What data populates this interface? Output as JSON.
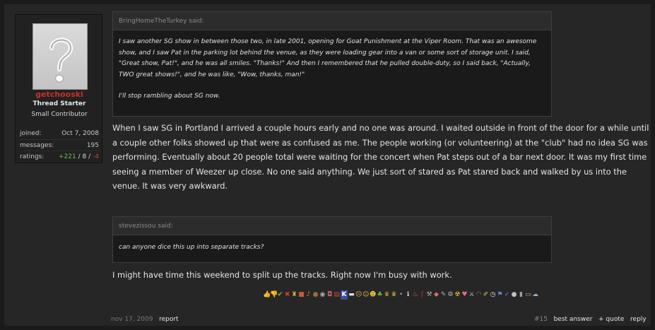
{
  "user": {
    "avatar_icon": "question-mark-avatar-icon",
    "name": "getchooski",
    "title": "Thread Starter",
    "rank": "Small Contributor",
    "stats": {
      "joined_label": "joined:",
      "joined_value": "Oct 7, 2008",
      "messages_label": "messages:",
      "messages_value": "195",
      "ratings_label": "ratings:",
      "ratings_pos": "+221",
      "ratings_sep1": " / ",
      "ratings_neu": "8",
      "ratings_sep2": " / ",
      "ratings_neg": "-4"
    }
  },
  "quote1": {
    "author": "BringHomeTheTurkey said:",
    "para1": "I saw another SG show in between those two, in late 2001, opening for Goat Punishment at the Viper Room. That was an awesome show, and I saw Pat in the parking lot behind the venue, as they were loading gear into a van or some sort of storage unit. I said, \"Great show, Pat!\", and he was all smiles. \"Thanks!\" And then I remembered that he pulled double-duty, so I said back, \"Actually, TWO great shows!\", and he was like, \"Wow, thanks, man!\"",
    "para2": "I'll stop rambling about SG now."
  },
  "message1": "When I saw SG in Portland I arrived a couple hours early and no one was around. I waited outside in front of the door for a while until a couple other folks showed up that were as confused as me. The people working (or volunteering) at the \"club\" had no idea SG was performing. Eventually about 20 people total were waiting for the concert when Pat steps out of a bar next door. It was my first time seeing a member of Weezer up close. No one said anything. We just sort of stared as Pat stared back and walked by us into the venue. It was very awkward.",
  "quote2": {
    "author": "stevezissou said:",
    "body": "can anyone dice this up into separate tracks?"
  },
  "message2": "I might have time this weekend to split up the tracks. Right now I'm busy with work.",
  "reactions": [
    {
      "name": "thumbs-up-icon",
      "glyph": "👍",
      "color": "#d9a066"
    },
    {
      "name": "thumbs-down-icon",
      "glyph": "👎",
      "color": "#c8843a"
    },
    {
      "name": "checkmark-icon",
      "glyph": "✔",
      "color": "#6cc04a"
    },
    {
      "name": "x-icon",
      "glyph": "✖",
      "color": "#d23b2f"
    },
    {
      "name": "trophy-icon",
      "glyph": "♜",
      "color": "#d9b44a"
    },
    {
      "name": "gift-icon",
      "glyph": "■",
      "color": "#c85a3a"
    },
    {
      "name": "guitar-icon",
      "glyph": "♪",
      "color": "#d98a3a"
    },
    {
      "name": "football-icon",
      "glyph": "●",
      "color": "#9a6a3a"
    },
    {
      "name": "disc-icon",
      "glyph": "◉",
      "color": "#b0b0b0"
    },
    {
      "name": "drum-icon",
      "glyph": "◘",
      "color": "#c85a5a"
    },
    {
      "name": "book-icon",
      "glyph": "▤",
      "color": "#c04a4a"
    },
    {
      "name": "k-icon",
      "glyph": "K",
      "color": "#ffffff"
    },
    {
      "name": "boat-icon",
      "glyph": "▬",
      "color": "#e0e0e0"
    },
    {
      "name": "sad-face-icon",
      "glyph": "☹",
      "color": "#e8c23a"
    },
    {
      "name": "surprised-face-icon",
      "glyph": "☺",
      "color": "#e8c23a"
    },
    {
      "name": "smile-face-icon",
      "glyph": "☻",
      "color": "#e8c23a"
    },
    {
      "name": "frog-icon",
      "glyph": "♣",
      "color": "#6cae4a"
    },
    {
      "name": "crown-icon",
      "glyph": "♛",
      "color": "#d9a03a"
    },
    {
      "name": "crown-icon-2",
      "glyph": "♛",
      "color": "#e0b040"
    },
    {
      "name": "dot-icon",
      "glyph": "•",
      "color": "#a0a0a0"
    },
    {
      "name": "info-icon",
      "glyph": "ℹ",
      "color": "#e0e0e0"
    },
    {
      "name": "fire-icon",
      "glyph": "♨",
      "color": "#e06a2a"
    },
    {
      "name": "chili-icon",
      "glyph": "ʃ",
      "color": "#d23b2f"
    },
    {
      "name": "wrench-icon",
      "glyph": "⚒",
      "color": "#b0b0b0"
    },
    {
      "name": "pill-icon",
      "glyph": "◆",
      "color": "#e06a6a"
    },
    {
      "name": "syringe-icon",
      "glyph": "✎",
      "color": "#b0b0b0"
    },
    {
      "name": "gear-icon",
      "glyph": "⚙",
      "color": "#c0c0c0"
    },
    {
      "name": "radiation-icon",
      "glyph": "☢",
      "color": "#e8c23a"
    },
    {
      "name": "heart-icon",
      "glyph": "♥",
      "color": "#e06a8a"
    },
    {
      "name": "tools-icon",
      "glyph": "⚔",
      "color": "#c0c0c0"
    },
    {
      "name": "rainbow-icon",
      "glyph": "◠",
      "color": "#d98a3a"
    },
    {
      "name": "pencil-icon",
      "glyph": "✐",
      "color": "#e0c04a"
    },
    {
      "name": "clock-icon",
      "glyph": "◷",
      "color": "#e0e0e0"
    },
    {
      "name": "flag-icon",
      "glyph": "⚑",
      "color": "#6a8ad0"
    },
    {
      "name": "check-circle-icon",
      "glyph": "✓",
      "color": "#6a8ad0"
    },
    {
      "name": "speech-icon",
      "glyph": "●",
      "color": "#c0c0c0"
    },
    {
      "name": "trash-icon",
      "glyph": "▮",
      "color": "#a0a0a0"
    },
    {
      "name": "box-icon",
      "glyph": "▭",
      "color": "#d9a066"
    },
    {
      "name": "cloud-icon",
      "glyph": "☁",
      "color": "#8ab0d0"
    }
  ],
  "footer": {
    "date": "nov 17, 2009",
    "report": "report",
    "post_number": "#15",
    "best_answer": "best answer",
    "quote": "+ quote",
    "reply": "reply"
  }
}
